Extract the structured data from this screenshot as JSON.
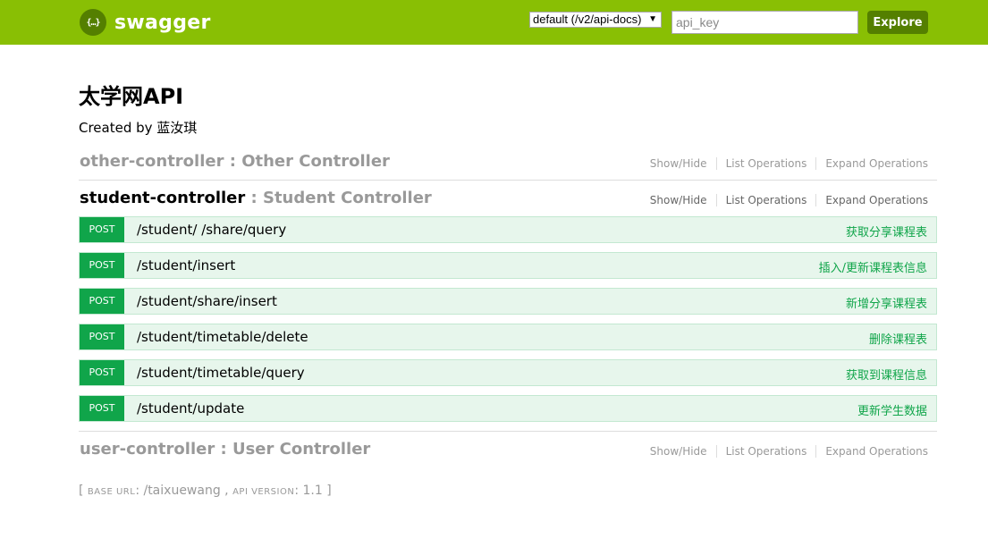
{
  "header": {
    "logo_symbol": "{…}",
    "logo_text": "swagger",
    "spec_select": "default (/v2/api-docs)",
    "api_key_placeholder": "api_key",
    "explore_label": "Explore",
    "brand_color": "#89bf04",
    "dark_green": "#547f00"
  },
  "info": {
    "title": "太学网API",
    "created_by": "Created by 蓝汝琪"
  },
  "controllers": [
    {
      "name": "other-controller",
      "separator": " : ",
      "description": "Other Controller",
      "links": [
        "Show/Hide",
        "List Operations",
        "Expand Operations"
      ]
    },
    {
      "name": "student-controller",
      "separator": " : ",
      "description": "Student Controller",
      "links": [
        "Show/Hide",
        "List Operations",
        "Expand Operations"
      ],
      "operations": [
        {
          "method": "POST",
          "path": "/student/ /share/query",
          "summary": "获取分享课程表"
        },
        {
          "method": "POST",
          "path": "/student/insert",
          "summary": "插入/更新课程表信息"
        },
        {
          "method": "POST",
          "path": "/student/share/insert",
          "summary": "新增分享课程表"
        },
        {
          "method": "POST",
          "path": "/student/timetable/delete",
          "summary": "删除课程表"
        },
        {
          "method": "POST",
          "path": "/student/timetable/query",
          "summary": "获取到课程信息"
        },
        {
          "method": "POST",
          "path": "/student/update",
          "summary": "更新学生数据"
        }
      ]
    },
    {
      "name": "user-controller",
      "separator": " : ",
      "description": "User Controller",
      "links": [
        "Show/Hide",
        "List Operations",
        "Expand Operations"
      ]
    }
  ],
  "footer": {
    "open_bracket": "[ ",
    "base_url_label": "BASE URL",
    "base_url": ": /taixuewang",
    "comma": " , ",
    "api_version_label": "API VERSION",
    "api_version": ": 1.1",
    "close_bracket": " ]"
  }
}
